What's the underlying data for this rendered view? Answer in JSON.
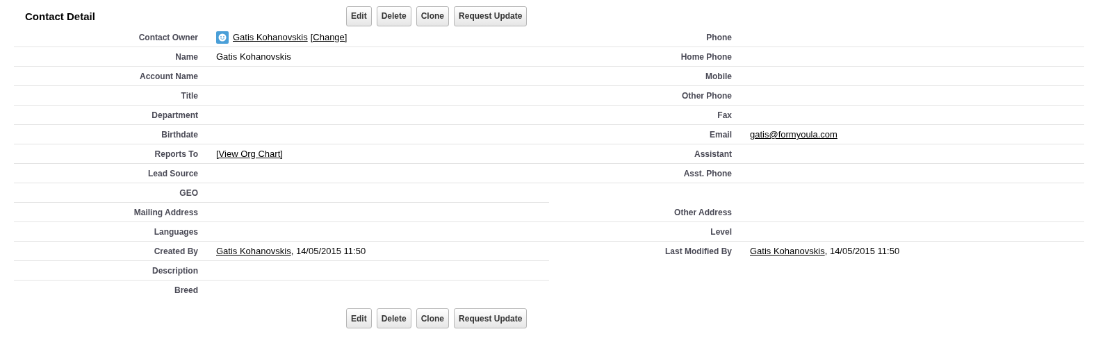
{
  "title": "Contact Detail",
  "top_buttons": [
    "Edit",
    "Delete",
    "Clone",
    "Request Update"
  ],
  "rows": [
    {
      "left": {
        "label": "Contact Owner",
        "value": [
          {
            "kind": "avatar"
          },
          {
            "kind": "link",
            "text": "Gatis Kohanovskis"
          },
          {
            "kind": "link",
            "text": "[Change]"
          }
        ]
      },
      "right": {
        "label": "Phone"
      }
    },
    {
      "left": {
        "label": "Name",
        "value": [
          {
            "kind": "text",
            "text": "Gatis Kohanovskis"
          }
        ]
      },
      "right": {
        "label": "Home Phone"
      }
    },
    {
      "left": {
        "label": "Account Name"
      },
      "right": {
        "label": "Mobile"
      }
    },
    {
      "left": {
        "label": "Title"
      },
      "right": {
        "label": "Other Phone"
      }
    },
    {
      "left": {
        "label": "Department"
      },
      "right": {
        "label": "Fax"
      }
    },
    {
      "left": {
        "label": "Birthdate"
      },
      "right": {
        "label": "Email",
        "value": [
          {
            "kind": "link",
            "text": "gatis@formyoula.com"
          }
        ]
      }
    },
    {
      "left": {
        "label": "Reports To",
        "value": [
          {
            "kind": "link",
            "text": "[View Org Chart]"
          }
        ]
      },
      "right": {
        "label": "Assistant"
      }
    },
    {
      "left": {
        "label": "Lead Source"
      },
      "right": {
        "label": "Asst. Phone"
      }
    },
    {
      "left": {
        "label": "GEO"
      }
    },
    {
      "left": {
        "label": "Mailing Address"
      },
      "right": {
        "label": "Other Address"
      }
    },
    {
      "left": {
        "label": "Languages"
      },
      "right": {
        "label": "Level"
      }
    },
    {
      "left": {
        "label": "Created By",
        "value": [
          {
            "kind": "link",
            "text": "Gatis Kohanovskis"
          },
          {
            "kind": "suffix",
            "text": ", 14/05/2015 11:50"
          }
        ]
      },
      "right": {
        "label": "Last Modified By",
        "value": [
          {
            "kind": "link",
            "text": "Gatis Kohanovskis"
          },
          {
            "kind": "suffix",
            "text": ", 14/05/2015 11:50"
          }
        ]
      }
    },
    {
      "left": {
        "label": "Description"
      }
    },
    {
      "left": {
        "label": "Breed"
      }
    }
  ],
  "bottom_buttons": [
    "Edit",
    "Delete",
    "Clone",
    "Request Update"
  ]
}
